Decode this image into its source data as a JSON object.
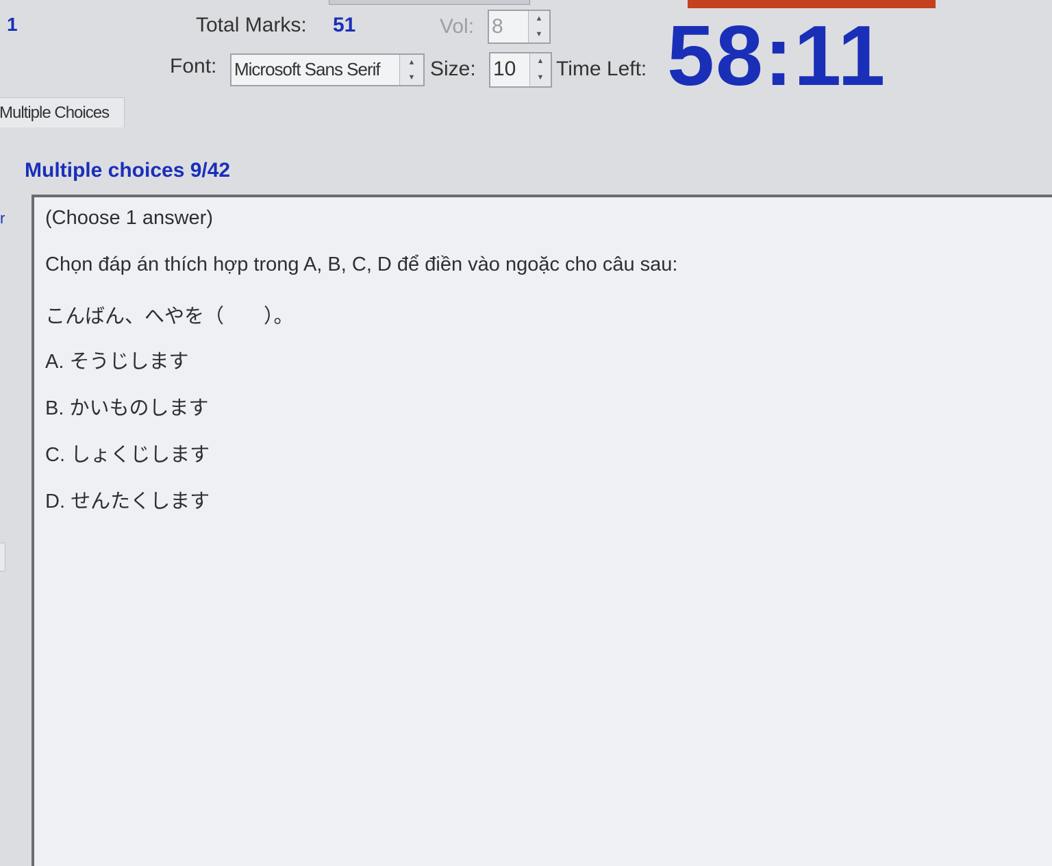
{
  "header": {
    "question_number": "1",
    "total_marks_label": "Total Marks:",
    "total_marks_value": "51",
    "vol_label": "Vol:",
    "vol_value": "8",
    "font_label": "Font:",
    "font_value": "Microsoft Sans Serif",
    "size_label": "Size:",
    "size_value": "10",
    "time_left_label": "Time Left:",
    "time_left_value": "58:11"
  },
  "tabs": [
    {
      "label": "Multiple Choices"
    }
  ],
  "section": {
    "title": "Multiple choices 9/42"
  },
  "question": {
    "instruction": "(Choose 1 answer)",
    "prompt": "Chọn đáp án thích hợp trong A, B, C, D để điền vào ngoặc cho câu sau:",
    "sentence": "こんばん、へやを（　　）。",
    "options": [
      {
        "letter": "A.",
        "text": "そうじします"
      },
      {
        "letter": "B.",
        "text": "かいものします"
      },
      {
        "letter": "C.",
        "text": "しょくじします"
      },
      {
        "letter": "D.",
        "text": "せんたくします"
      }
    ]
  },
  "colors": {
    "accent_blue": "#1a2fb8",
    "red_bar": "#c5411f",
    "background": "#dcdde1",
    "panel": "#eff0f3"
  }
}
